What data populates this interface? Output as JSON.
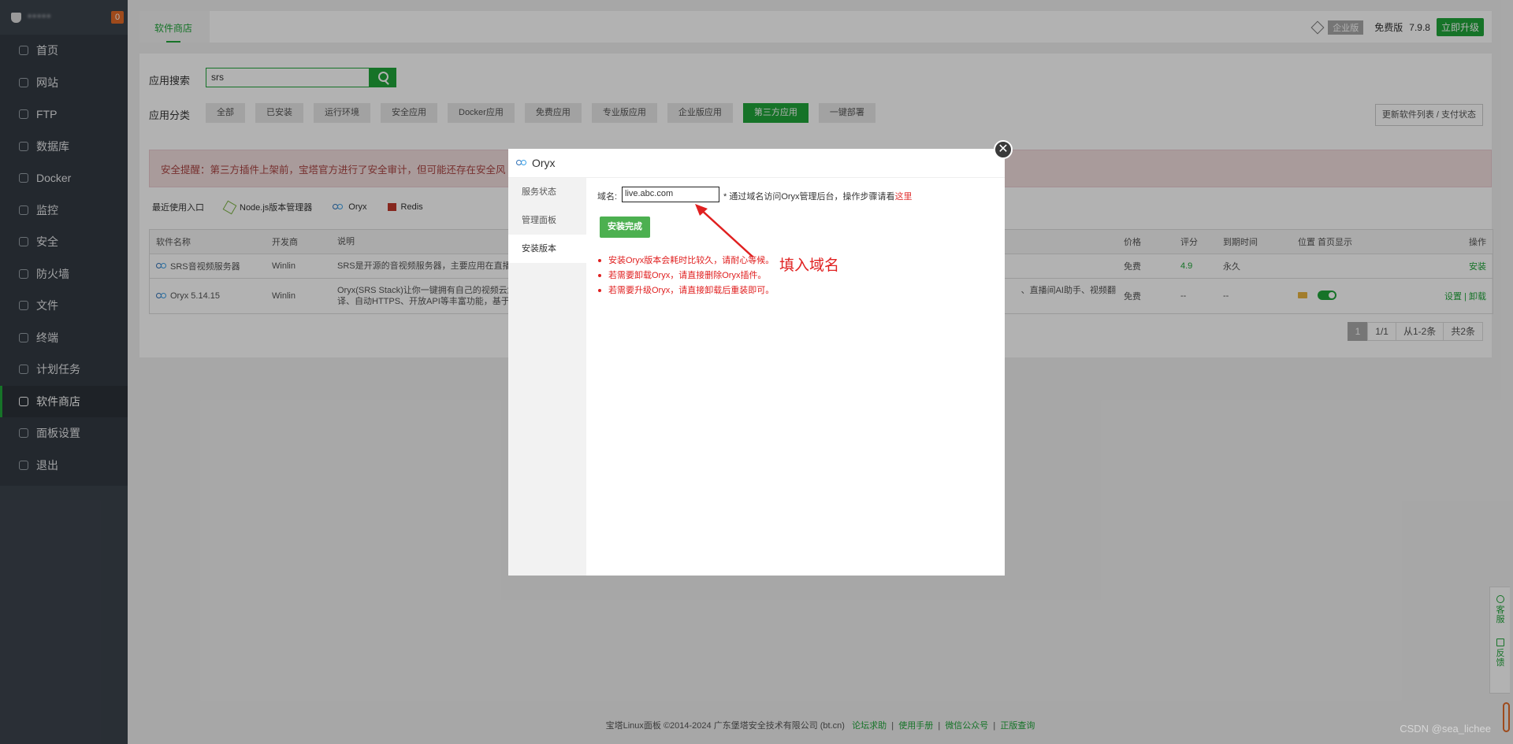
{
  "sidebar": {
    "user": "*****",
    "badge": "0",
    "items": [
      {
        "label": "首页",
        "icon": "home-icon"
      },
      {
        "label": "网站",
        "icon": "globe-icon"
      },
      {
        "label": "FTP",
        "icon": "ftp-icon"
      },
      {
        "label": "数据库",
        "icon": "database-icon"
      },
      {
        "label": "Docker",
        "icon": "docker-icon"
      },
      {
        "label": "监控",
        "icon": "monitor-icon"
      },
      {
        "label": "安全",
        "icon": "shield-icon"
      },
      {
        "label": "防火墙",
        "icon": "firewall-icon"
      },
      {
        "label": "文件",
        "icon": "folder-icon"
      },
      {
        "label": "终端",
        "icon": "terminal-icon"
      },
      {
        "label": "计划任务",
        "icon": "calendar-icon"
      },
      {
        "label": "软件商店",
        "icon": "grid-icon",
        "active": true
      },
      {
        "label": "面板设置",
        "icon": "gear-icon"
      },
      {
        "label": "退出",
        "icon": "logout-icon"
      }
    ]
  },
  "topbar": {
    "tab": "软件商店",
    "enterprise": "企业版",
    "free": "免费版",
    "version": "7.9.8",
    "upgrade": "立即升级"
  },
  "search": {
    "label": "应用搜索",
    "value": "srs"
  },
  "categories": {
    "label": "应用分类",
    "items": [
      "全部",
      "已安装",
      "运行环境",
      "安全应用",
      "Docker应用",
      "免费应用",
      "专业版应用",
      "企业版应用",
      "第三方应用",
      "一键部署"
    ],
    "active_index": 8,
    "refresh": "更新软件列表 / 支付状态"
  },
  "alert": "安全提醒：第三方插件上架前，宝塔官方进行了安全审计，但可能还存在安全风",
  "recent": {
    "label": "最近使用入口",
    "items": [
      "Node.js版本管理器",
      "Oryx",
      "Redis"
    ]
  },
  "table": {
    "headers": [
      "软件名称",
      "开发商",
      "说明",
      "价格",
      "评分",
      "到期时间",
      "位置",
      "首页显示",
      "操作"
    ],
    "rows": [
      {
        "name": "SRS音视频服务器",
        "dev": "Winlin",
        "desc": "SRS是开源的音视频服务器，主要应用在直播和",
        "price": "免费",
        "rate": "4.9",
        "expire": "永久",
        "op": "安装"
      },
      {
        "name": "Oryx 5.14.15",
        "dev": "Winlin",
        "desc": "Oryx(SRS Stack)让你一键拥有自己的视频云解",
        "desc2": "译、自动HTTPS、开放API等丰富功能，基于S",
        "desc_right": "、直播间AI助手、视频翻",
        "price": "免费",
        "rate": "--",
        "expire": "--",
        "op_settings": "设置",
        "op_uninstall": "卸载"
      }
    ]
  },
  "pager": [
    "1",
    "1/1",
    "从1-2条",
    "共2条"
  ],
  "modal": {
    "title": "Oryx",
    "tabs": [
      "服务状态",
      "管理面板",
      "安装版本"
    ],
    "active_tab": 2,
    "domain_label": "域名:",
    "domain_value": "live.abc.com",
    "domain_note": "* 通过域名访问Oryx管理后台，操作步骤请看",
    "domain_here": "这里",
    "done_button": "安装完成",
    "notes": [
      "安装Oryx版本会耗时比较久，请耐心等候。",
      "若需要卸载Oryx，请直接删除Oryx插件。",
      "若需要升级Oryx，请直接卸载后重装即可。"
    ]
  },
  "annotation": "填入域名",
  "footer": {
    "text": "宝塔Linux面板 ©2014-2024 广东堡塔安全技术有限公司 (bt.cn)",
    "links": [
      "论坛求助",
      "使用手册",
      "微信公众号",
      "正版查询"
    ]
  },
  "side_float": [
    "客服",
    "反馈"
  ],
  "watermark": "CSDN @sea_lichee",
  "colors": {
    "accent": "#20a53a",
    "sidebar": "#3c444d",
    "alert_text": "#a94442",
    "annotation": "#e02020"
  }
}
